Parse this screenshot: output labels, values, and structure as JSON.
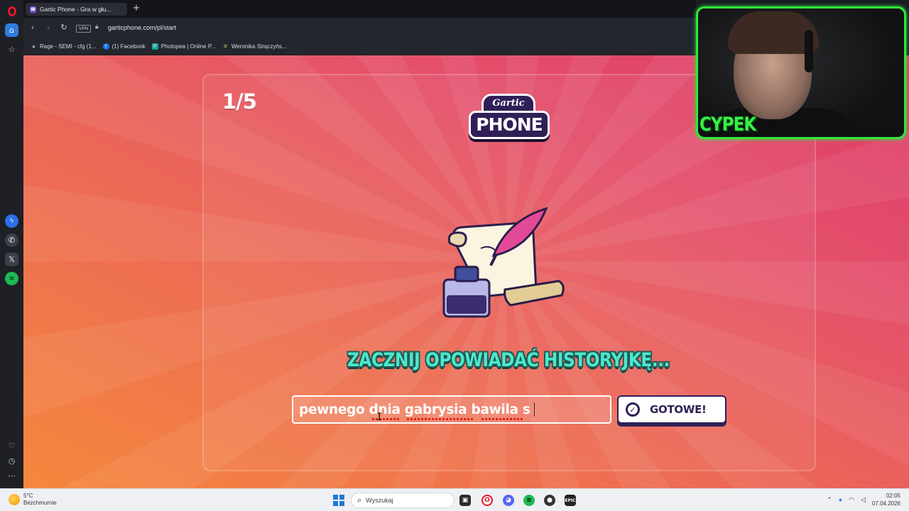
{
  "browser": {
    "active_tab_title": "Gartic Phone - Gra w głu...",
    "url": "garticphone.com/pl/start",
    "vpn_label": "VPN",
    "bookmarks": [
      {
        "label": "Rage - SEMI - cfg (1..."
      },
      {
        "label": "(1) Facebook"
      },
      {
        "label": "Photopea | Online P..."
      },
      {
        "label": "Weronika Strączyńs..."
      }
    ]
  },
  "webcam": {
    "streamer_name": "CYPEK",
    "frame_color": "#2ee83a"
  },
  "game": {
    "round_counter": "1/5",
    "logo_top": "Gartic",
    "logo_bottom": "PHONE",
    "prompt_title": "ZACZNIJ OPOWIADAĆ HISTORYJKĘ...",
    "story_input_value": "pewnego dnia gabrysia bawila s",
    "done_button_label": "GOTOWE!",
    "colors": {
      "background_top": "#dd3b66",
      "background_bottom": "#f5873d",
      "title_color": "#4ce8cc",
      "logo_color": "#301f56"
    }
  },
  "taskbar": {
    "weather_temp": "5°C",
    "weather_desc": "Bezchmurnie",
    "search_placeholder": "Wyszukaj",
    "time": "02:05",
    "date": "07.04.2026"
  }
}
